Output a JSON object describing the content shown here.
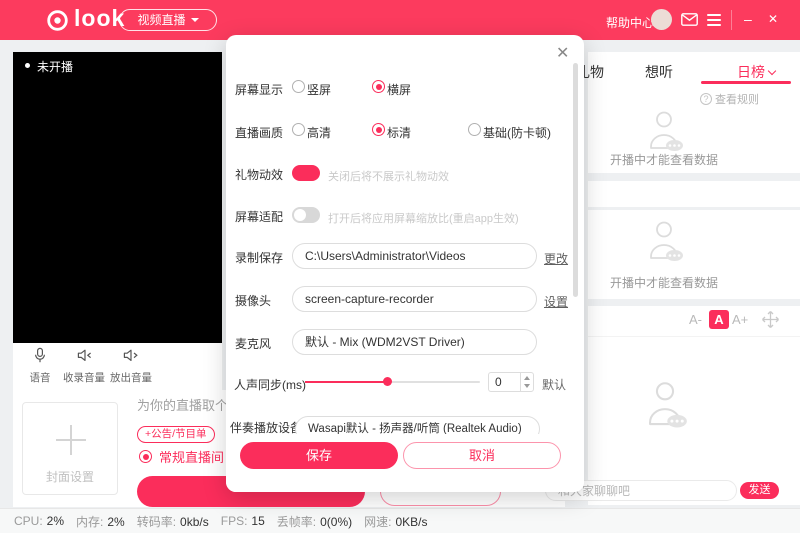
{
  "colors": {
    "brand_red": "#fc3b5e",
    "accent_pink": "#fb2d5b"
  },
  "header": {
    "logo": "look",
    "stream_mode": "视频直播",
    "help_center": "帮助中心",
    "minimize": "–",
    "close": "✕"
  },
  "preview": {
    "status": "未开播",
    "controls": [
      {
        "icon": "mic-icon",
        "label": "语音"
      },
      {
        "icon": "speaker-in-icon",
        "label": "收录音量"
      },
      {
        "icon": "speaker-out-icon",
        "label": "放出音量"
      }
    ]
  },
  "setup": {
    "cover": "封面设置",
    "title_placeholder": "为你的直播取个好名字",
    "announcement": "+公告/节目单",
    "room_type": "常规直播间"
  },
  "dialog": {
    "close": "✕",
    "screen_display": {
      "label": "屏幕显示",
      "options": [
        {
          "label": "竖屏",
          "selected": false
        },
        {
          "label": "横屏",
          "selected": true
        }
      ]
    },
    "quality": {
      "label": "直播画质",
      "options": [
        {
          "label": "高清",
          "selected": false
        },
        {
          "label": "标清",
          "selected": true
        },
        {
          "label": "基础(防卡顿)",
          "selected": false
        }
      ]
    },
    "gift_effect": {
      "label": "礼物动效",
      "on": true,
      "hint": "关闭后将不展示礼物动效"
    },
    "screen_fit": {
      "label": "屏幕适配",
      "on": false,
      "hint": "打开后将应用屏幕缩放比(重启app生效)"
    },
    "record_save": {
      "label": "录制保存",
      "value": "C:\\Users\\Administrator\\Videos",
      "action": "更改"
    },
    "camera": {
      "label": "摄像头",
      "value": "screen-capture-recorder",
      "action": "设置"
    },
    "microphone": {
      "label": "麦克风",
      "value": "默认 - Mix (WDM2VST Driver)"
    },
    "voice_sync": {
      "label": "人声同步(ms)",
      "value": "0",
      "suffix": "默认"
    },
    "accompaniment": {
      "label": "伴奏播放设备",
      "value": "Wasapi默认 - 扬声器/听筒 (Realtek Audio)"
    },
    "save": "保存",
    "cancel": "取消"
  },
  "right": {
    "tabs": [
      {
        "label": "礼物",
        "selected": false
      },
      {
        "label": "想听",
        "selected": false
      },
      {
        "label": "日榜",
        "selected": true
      }
    ],
    "rules": "查看规则",
    "empty_hint": "开播中才能查看数据",
    "font_small": "A-",
    "font_current": "A",
    "font_large": "A+",
    "chat_placeholder": "和大家聊聊吧",
    "send": "发送"
  },
  "status_bar": [
    {
      "label": "CPU:",
      "value": "2%"
    },
    {
      "label": "内存:",
      "value": "2%"
    },
    {
      "label": "转码率:",
      "value": "0kb/s"
    },
    {
      "label": "FPS:",
      "value": "15"
    },
    {
      "label": "丢帧率:",
      "value": "0(0%)"
    },
    {
      "label": "网速:",
      "value": "0KB/s"
    }
  ]
}
